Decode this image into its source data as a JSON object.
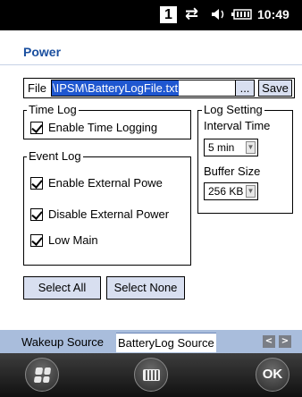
{
  "status_bar": {
    "badge": "1",
    "connectivity_icon": "sync-arrows-icon",
    "volume_icon": "speaker-icon",
    "battery_icon": "battery-icon",
    "time": "10:49"
  },
  "page": {
    "title": "Power"
  },
  "file": {
    "label": "File",
    "value": "\\IPSM\\BatteryLogFile.txt",
    "browse_label": "...",
    "save_label": "Save"
  },
  "time_log": {
    "legend": "Time Log",
    "enable_time_logging": {
      "label": "Enable Time Logging",
      "checked": true
    }
  },
  "event_log": {
    "legend": "Event Log",
    "items": [
      {
        "label": "Enable External Powe",
        "checked": true
      },
      {
        "label": "Disable External Power",
        "checked": true
      },
      {
        "label": "Low Main",
        "checked": true
      }
    ]
  },
  "log_setting": {
    "legend": "Log Setting",
    "interval_label": "Interval Time",
    "interval_value": "5 min",
    "buffer_label": "Buffer Size",
    "buffer_value": "256 KB"
  },
  "buttons": {
    "select_all": "Select All",
    "select_none": "Select None"
  },
  "tabs": [
    {
      "label": "Wakeup Source",
      "active": false
    },
    {
      "label": "BatteryLog Source",
      "active": true
    }
  ],
  "softkeys": {
    "ok": "OK"
  }
}
